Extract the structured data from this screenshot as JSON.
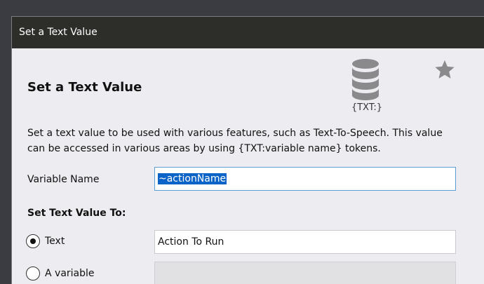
{
  "window": {
    "title": "Set a Text Value"
  },
  "dialog": {
    "heading": "Set a Text Value",
    "icon_label": "{TXT:}",
    "description": "Set a text value to be used with various features, such as Text-To-Speech.  This value can be accessed in various areas by using {TXT:variable name} tokens."
  },
  "variable_name": {
    "label": "Variable Name",
    "value": "~actionName"
  },
  "set_text_value": {
    "title": "Set Text Value To:",
    "options": [
      {
        "label": "Text",
        "selected": true
      },
      {
        "label": "A variable",
        "selected": false
      }
    ],
    "text_value": "Action To Run",
    "variable_value": ""
  },
  "colors": {
    "titlebar": "#2d2e2a",
    "panel": "#edecf0",
    "selection": "#0a64c8",
    "focus_border": "#5a9fd4"
  },
  "icons": [
    "database-icon",
    "star-icon"
  ]
}
